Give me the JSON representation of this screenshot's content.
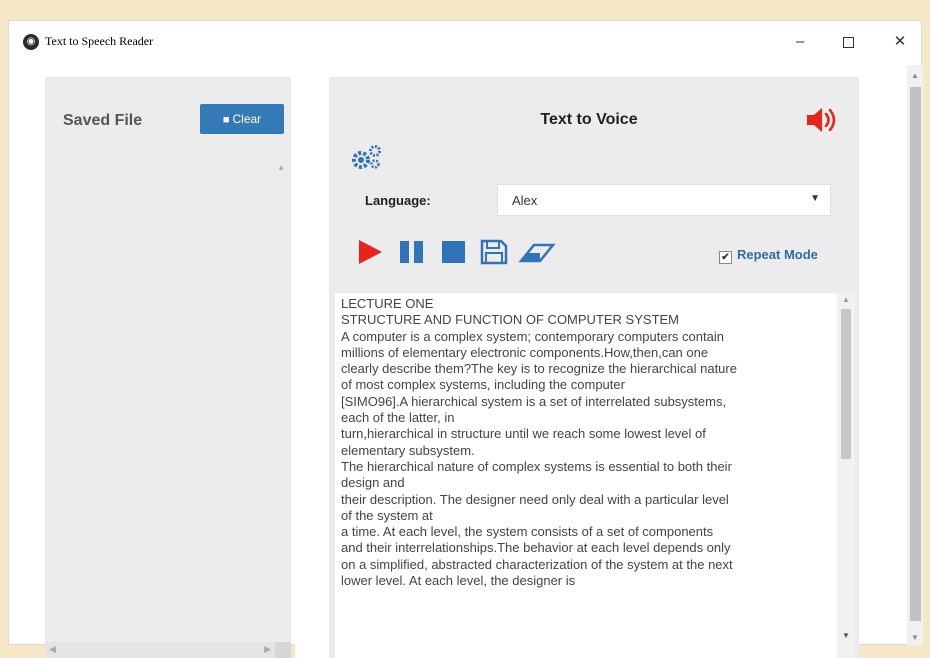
{
  "window": {
    "title": "Text to Speech Reader",
    "app_icon": "tts-app-icon",
    "minimize": "–",
    "close": "✕"
  },
  "left_panel": {
    "title": "Saved File",
    "clear_label": "Clear",
    "clear_icon": "trash-icon"
  },
  "main": {
    "title": "Text to Voice",
    "language_label": "Language:",
    "language_value": "Alex",
    "repeat_label": "Repeat Mode",
    "repeat_checked": true,
    "text": "LECTURE ONE\n STRUCTURE AND FUNCTION OF COMPUTER SYSTEM\nA computer is a complex system; contemporary computers contain\nmillions of elementary electronic components.How,then,can one\nclearly describe them?The key is to recognize the hierarchical nature\nof most complex systems, including the computer\n[SIMO96].A hierarchical system is a set of interrelated subsystems,\neach of the latter, in\nturn,hierarchical in structure until we reach some lowest level of\nelementary subsystem.\nThe hierarchical nature of complex systems is essential to both their\ndesign and\ntheir description. The designer need only deal with a particular level\nof the system at\na time. At each level, the system consists of a set of components\nand their interrelationships.The behavior at each level depends only\non a simplified, abstracted characterization of the system at the next\nlower level. At each level, the designer is"
  },
  "colors": {
    "accent_blue": "#337ab7",
    "play_red": "#e8231b",
    "control_blue": "#2f73b8",
    "repeat_text": "#2f6ca8"
  },
  "icons": {
    "speaker": "speaker-volume-icon",
    "settings": "gears-icon",
    "play": "play-icon",
    "pause": "pause-icon",
    "stop": "stop-icon",
    "save": "save-icon",
    "eraser": "eraser-icon"
  }
}
